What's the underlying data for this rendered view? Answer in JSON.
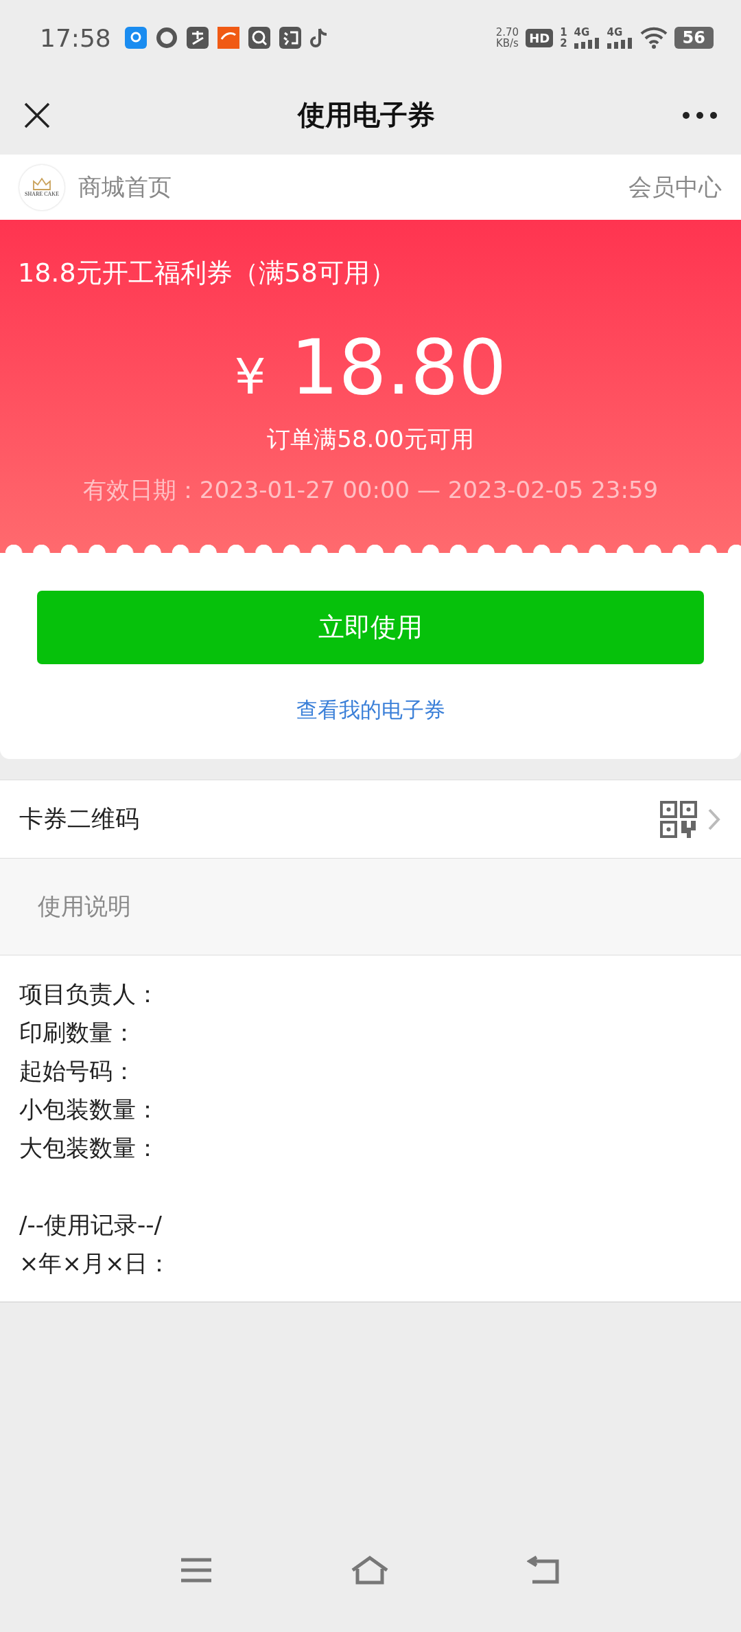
{
  "status_bar": {
    "time": "17:58",
    "speed": "2.70",
    "speed_unit": "KB/s",
    "hd": "HD",
    "sims": [
      "1",
      "2"
    ],
    "networks": [
      "4G",
      "4G"
    ],
    "battery": "56"
  },
  "nav": {
    "title": "使用电子券"
  },
  "shop_bar": {
    "logo_text": "SHARE CAKE",
    "home": "商城首页",
    "member": "会员中心"
  },
  "coupon": {
    "name": "18.8元开工福利券（满58可用）",
    "currency": "¥",
    "amount": "18.80",
    "condition": "订单满58.00元可用",
    "validity": "有效日期：2023-01-27 00:00 — 2023-02-05 23:59"
  },
  "use_button": "立即使用",
  "my_coupons_link": "查看我的电子券",
  "qr_row": {
    "label": "卡券二维码"
  },
  "instructions": {
    "heading": "使用说明",
    "paragraphs": [
      [
        "项目负责人：",
        "印刷数量：",
        "起始号码：",
        "小包装数量：",
        "大包装数量："
      ],
      [
        "/--使用记录--/",
        "×年×月×日："
      ]
    ]
  }
}
